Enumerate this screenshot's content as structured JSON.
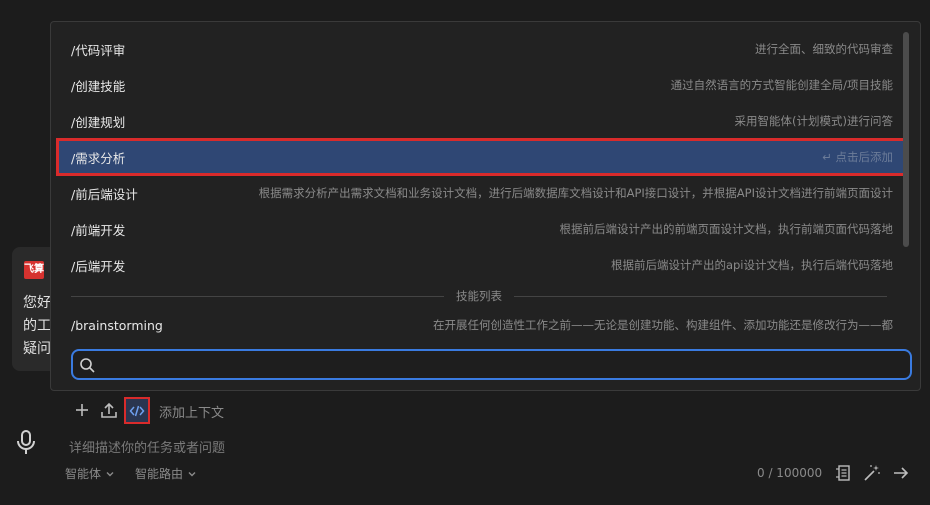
{
  "side_bubble": {
    "logo_text": "飞算",
    "lines": [
      "您好",
      "的工",
      "疑问"
    ]
  },
  "commands": [
    {
      "cmd": "/代码评审",
      "desc": "进行全面、细致的代码审查"
    },
    {
      "cmd": "/创建技能",
      "desc": "通过自然语言的方式智能创建全局/项目技能"
    },
    {
      "cmd": "/创建规划",
      "desc": "采用智能体(计划模式)进行问答"
    },
    {
      "cmd": "/需求分析",
      "desc": "↵ 点击后添加"
    },
    {
      "cmd": "/前后端设计",
      "desc": "根据需求分析产出需求文档和业务设计文档，进行后端数据库文档设计和API接口设计，并根据API设计文档进行前端页面设计"
    },
    {
      "cmd": "/前端开发",
      "desc": "根据前后端设计产出的前端页面设计文档，执行前端页面代码落地"
    },
    {
      "cmd": "/后端开发",
      "desc": "根据前后端设计产出的api设计文档，执行后端代码落地"
    }
  ],
  "skills_divider": "技能列表",
  "skills": [
    {
      "cmd": "/brainstorming",
      "desc": "在开展任何创造性工作之前——无论是创建功能、构建组件、添加功能还是修改行为——都"
    }
  ],
  "search": {
    "value": "",
    "placeholder": ""
  },
  "toolbar": {
    "add_context_label": "添加上下文"
  },
  "input": {
    "placeholder": "详细描述你的任务或者问题"
  },
  "footer": {
    "agent_dropdown": "智能体",
    "route_dropdown": "智能路由",
    "counter": "0 / 100000"
  },
  "colors": {
    "selected_row": "#2f4774",
    "highlight_border": "#d92b2b",
    "search_border": "#3a7be0"
  }
}
